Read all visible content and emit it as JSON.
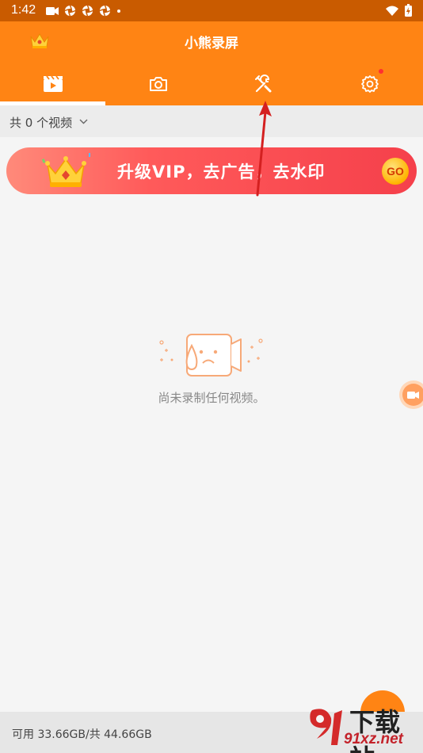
{
  "status_bar": {
    "time": "1:42"
  },
  "header": {
    "title": "小熊录屏",
    "active_tab": 0,
    "settings_badge": true
  },
  "tabs": [
    {
      "name": "videos"
    },
    {
      "name": "screenshots"
    },
    {
      "name": "tools"
    },
    {
      "name": "settings"
    }
  ],
  "count_bar": {
    "label": "共 0 个视频"
  },
  "vip_banner": {
    "text": "升级VIP，去广告，去水印",
    "go_label": "GO"
  },
  "empty_state": {
    "message": "尚未录制任何视频。"
  },
  "storage": {
    "text": "可用 33.66GB/共 44.66GB"
  },
  "watermark": {
    "big": "下载站",
    "small": "91xz.net"
  },
  "colors": {
    "header": "#ff8414",
    "status_bar": "#c95b00",
    "banner": "#f5404b",
    "annotation_arrow": "#d42020"
  }
}
